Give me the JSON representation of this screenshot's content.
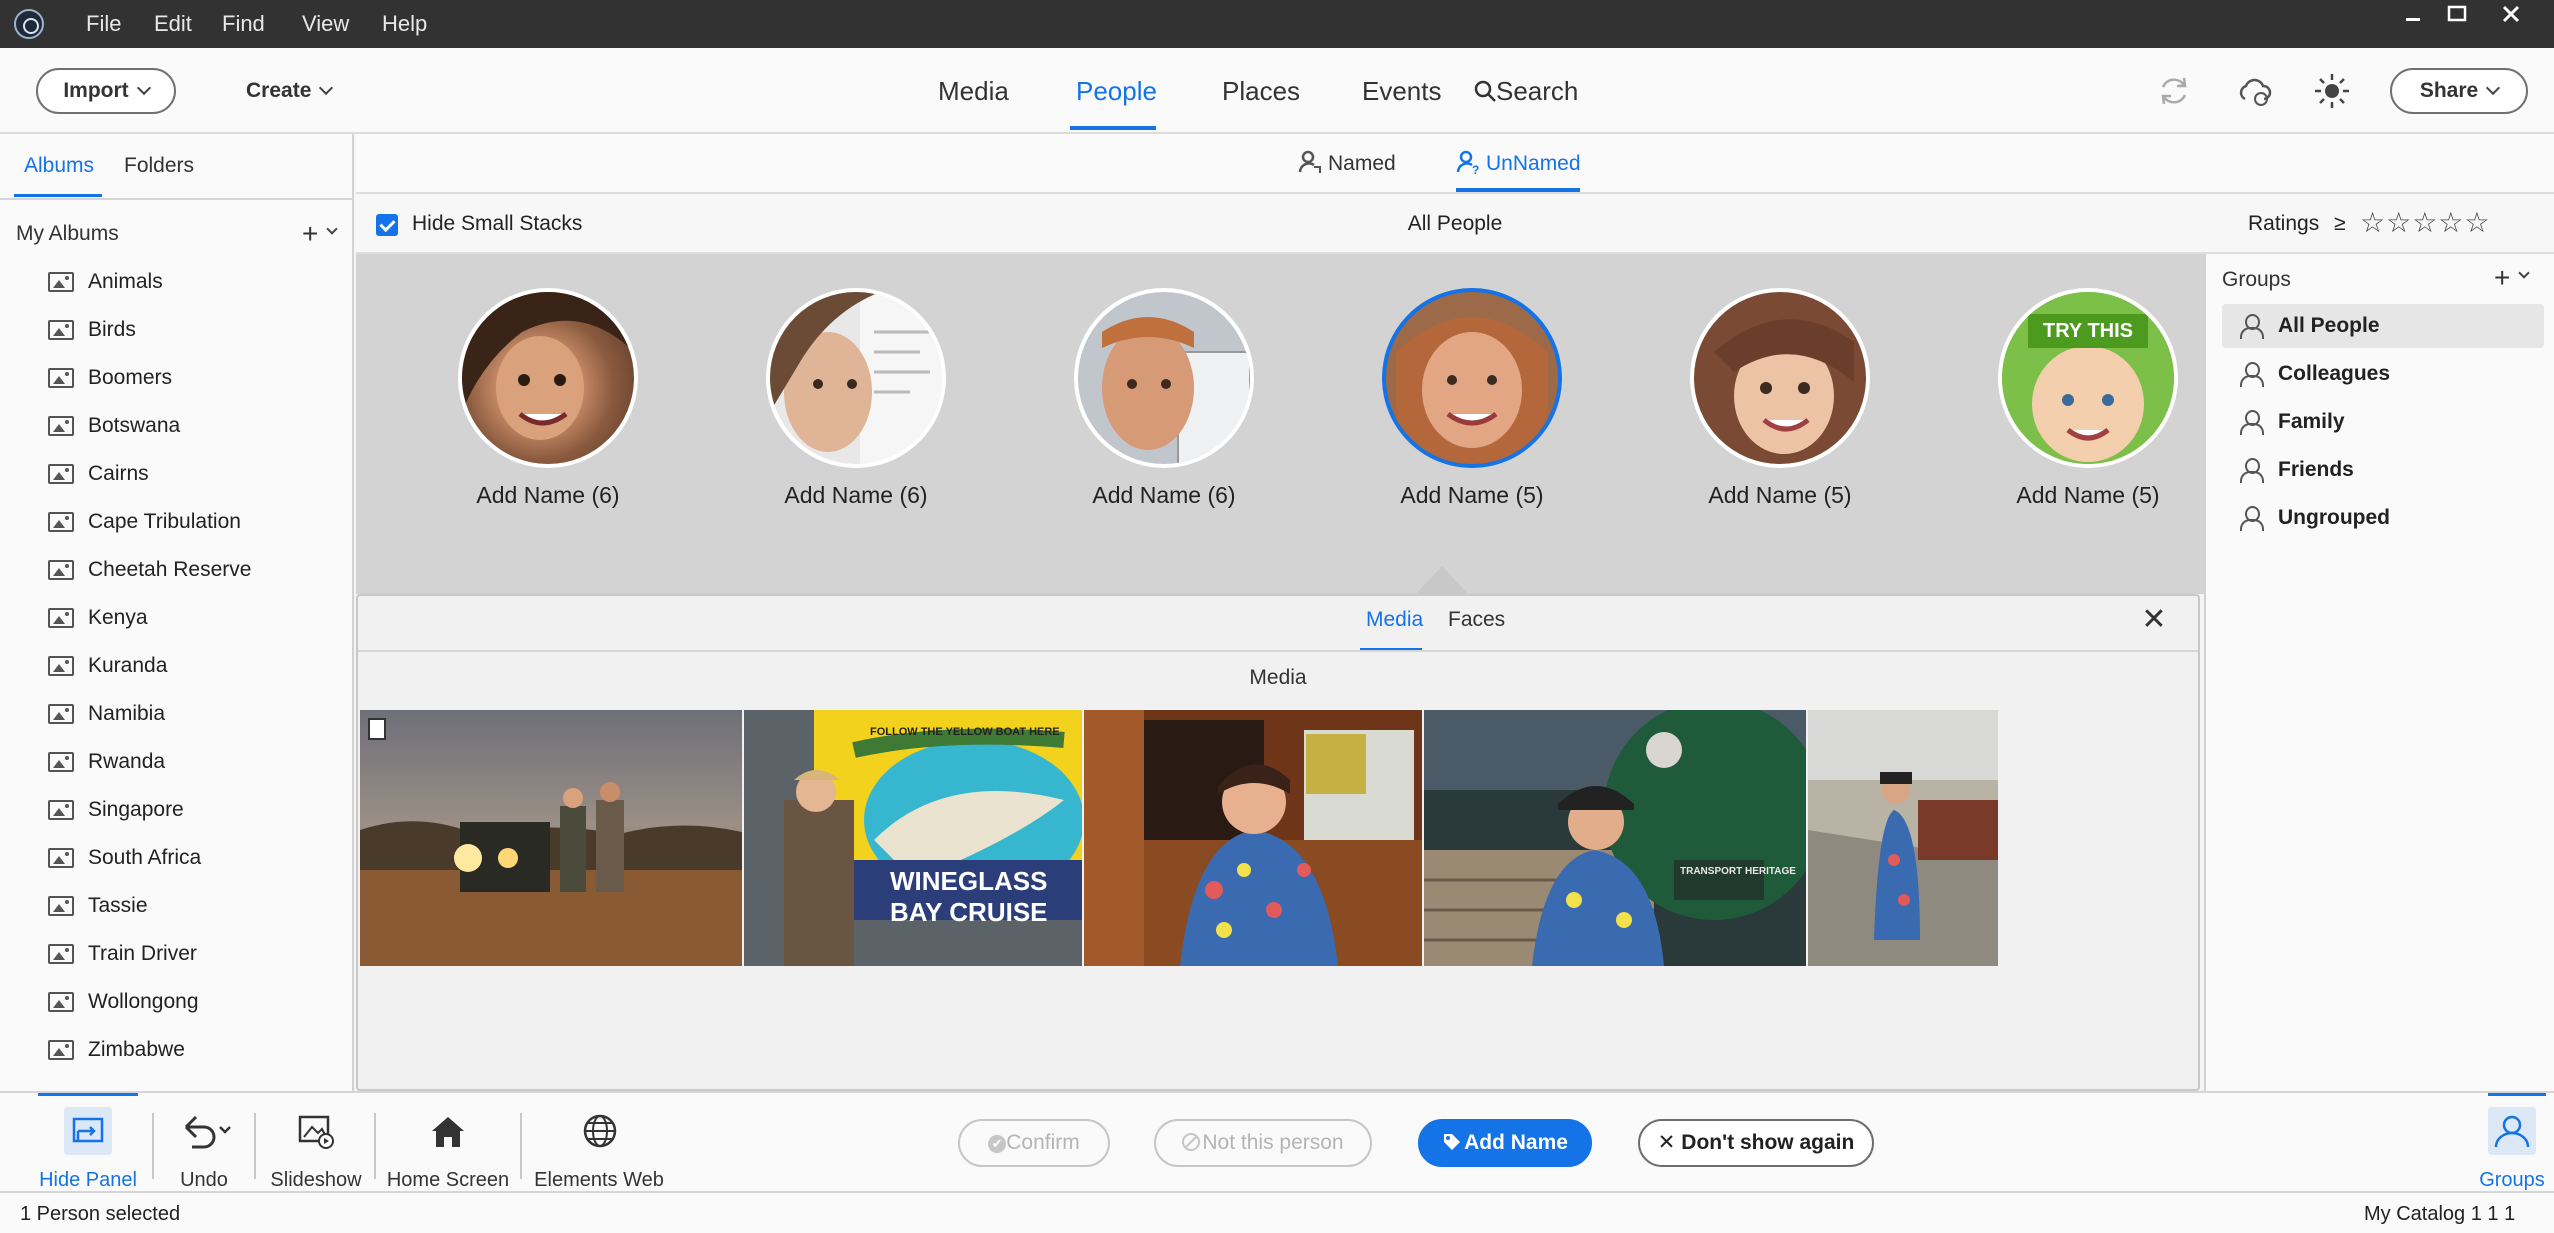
{
  "menubar": {
    "items": [
      "File",
      "Edit",
      "Find",
      "View",
      "Help"
    ]
  },
  "toolbar": {
    "import_label": "Import",
    "create_label": "Create",
    "share_label": "Share",
    "nav_tabs": [
      {
        "label": "Media",
        "active": false
      },
      {
        "label": "People",
        "active": true
      },
      {
        "label": "Places",
        "active": false
      },
      {
        "label": "Events",
        "active": false
      }
    ],
    "search_label": "Search"
  },
  "left_panel": {
    "tabs": [
      {
        "label": "Albums",
        "active": true
      },
      {
        "label": "Folders",
        "active": false
      }
    ],
    "section_title": "My Albums",
    "albums": [
      "Animals",
      "Birds",
      "Boomers",
      "Botswana",
      "Cairns",
      "Cape Tribulation",
      "Cheetah Reserve",
      "Kenya",
      "Kuranda",
      "Namibia",
      "Rwanda",
      "Singapore",
      "South Africa",
      "Tassie",
      "Train Driver",
      "Wollongong",
      "Zimbabwe"
    ]
  },
  "subtabs": {
    "named_label": "Named",
    "unnamed_label": "UnNamed",
    "active": "UnNamed"
  },
  "filterbar": {
    "hide_small_stacks_label": "Hide Small Stacks",
    "hide_small_stacks_checked": true,
    "center_title": "All People",
    "ratings_label": "Ratings",
    "ratings_operator": "≥",
    "ratings_stars": "☆☆☆☆☆"
  },
  "people": [
    {
      "name": "Add Name (6)",
      "selected": false
    },
    {
      "name": "Add Name (6)",
      "selected": false
    },
    {
      "name": "Add Name (6)",
      "selected": false
    },
    {
      "name": "Add Name (5)",
      "selected": true
    },
    {
      "name": "Add Name (5)",
      "selected": false
    },
    {
      "name": "Add Name (5)",
      "selected": false,
      "badge": "TRY THIS"
    }
  ],
  "groups_panel": {
    "title": "Groups",
    "groups": [
      {
        "label": "All People",
        "selected": true
      },
      {
        "label": "Colleagues",
        "selected": false
      },
      {
        "label": "Family",
        "selected": false
      },
      {
        "label": "Friends",
        "selected": false
      },
      {
        "label": "Ungrouped",
        "selected": false
      }
    ]
  },
  "detail_panel": {
    "tabs": [
      {
        "label": "Media",
        "active": true
      },
      {
        "label": "Faces",
        "active": false
      }
    ],
    "heading": "Media",
    "close_glyph": "✕",
    "thumbnails": [
      {
        "caption": ""
      },
      {
        "caption": "WINEGLASS BAY CRUISE",
        "banner_text": "FOLLOW THE YELLOW BOAT HERE"
      },
      {
        "caption": ""
      },
      {
        "caption": "TRANSPORT HERITAGE"
      },
      {
        "caption": ""
      }
    ]
  },
  "bottombar": {
    "hide_panel_label": "Hide Panel",
    "undo_label": "Undo",
    "slideshow_label": "Slideshow",
    "home_screen_label": "Home Screen",
    "elements_web_label": "Elements Web",
    "confirm_label": "Confirm",
    "not_this_person_label": "Not this person",
    "add_name_label": "Add Name",
    "dont_show_again_label": "Don't show again",
    "groups_label": "Groups"
  },
  "statusbar": {
    "left_text": "1 Person selected",
    "right_text": "My Catalog 1 1 1"
  },
  "colors": {
    "accent": "#1473e6",
    "menubar": "#323232",
    "people_area_bg": "#d3d3d3"
  }
}
